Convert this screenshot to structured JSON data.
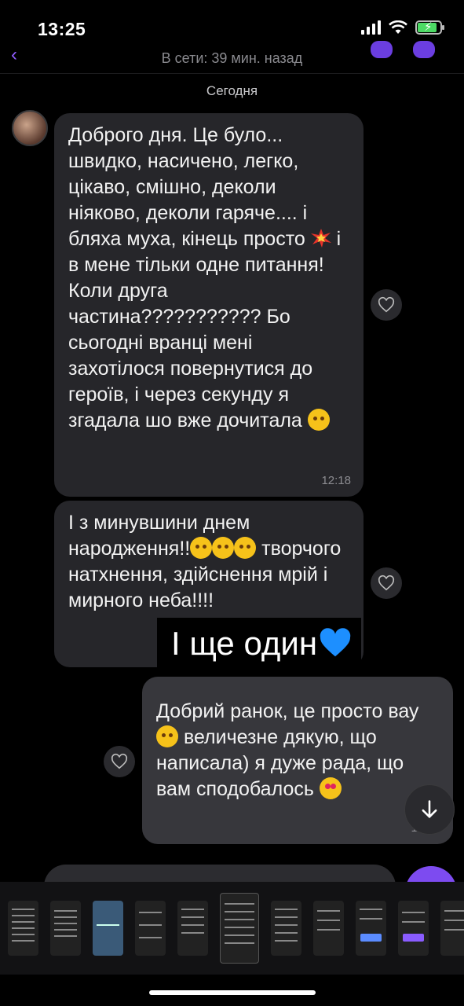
{
  "status_bar": {
    "time": "13:25"
  },
  "header": {
    "online_status": "В сети: 39 мин. назад"
  },
  "date_separator": "Сегодня",
  "messages": [
    {
      "direction": "incoming",
      "text_part1": "Доброго дня. Це було... швидко, насичено, легко, цікаво, смішно, деколи ніяково, деколи гаряче.... і бляха муха, кінець просто ",
      "emoji1": "collision",
      "text_part2": " і в мене тільки одне питання! Коли друга частина??????????? Бо сьогодні вранці мені захотілося повернутися до героїв, і через секунду я згадала шо вже дочитала ",
      "emoji2": "face-with-open-eyes-and-hand-over-mouth",
      "time": "12:18"
    },
    {
      "direction": "incoming",
      "text_part1": "І з минувшини днем народження!!",
      "emojis": [
        "partying-face",
        "partying-face",
        "partying-face"
      ],
      "text_part2": " творчого натхнення, здійснення мрій і мирного неба!!!!"
    },
    {
      "direction": "outgoing",
      "text_part1": "Добрий ранок, це просто вау",
      "emoji1": "star-struck",
      "text_part2": " величезне дякую, що написала) я дуже рада, що вам сподобалось ",
      "emoji2": "smiling-face-with-heart-eyes",
      "time": "12:21"
    }
  ],
  "overlay_sticker": {
    "text": "І ще один",
    "emoji": "blue-heart"
  },
  "colors": {
    "accent": "#7d4bf0",
    "bubble_in": "#26262a",
    "bubble_out": "#37373c"
  },
  "icons": [
    "heart-icon",
    "chevron-down-icon",
    "back-arrow-icon",
    "signal-icon",
    "wifi-icon",
    "battery-icon"
  ]
}
